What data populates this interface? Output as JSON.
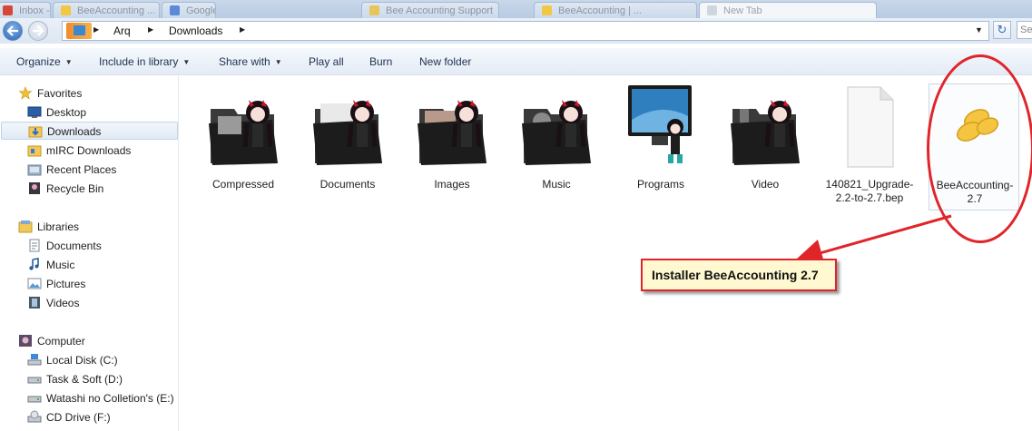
{
  "tabs": [
    {
      "label": "Inbox - ..."
    },
    {
      "label": "BeeAccounting ..."
    },
    {
      "label": "Google ..."
    },
    {
      "label": "Bee Accounting Support"
    },
    {
      "label": "BeeAccounting | ..."
    },
    {
      "label": "New Tab"
    }
  ],
  "address": {
    "crumbs": [
      "Arq",
      "Downloads"
    ],
    "search_placeholder": "Se"
  },
  "commands": {
    "organize": "Organize",
    "include": "Include in library",
    "share": "Share with",
    "play": "Play all",
    "burn": "Burn",
    "new_folder": "New folder"
  },
  "nav": {
    "favorites": "Favorites",
    "desktop": "Desktop",
    "downloads": "Downloads",
    "mirc": "mIRC Downloads",
    "recent": "Recent Places",
    "recycle": "Recycle Bin",
    "libraries": "Libraries",
    "documents": "Documents",
    "music": "Music",
    "pictures": "Pictures",
    "videos": "Videos",
    "computer": "Computer",
    "local_c": "Local Disk (C:)",
    "task_d": "Task & Soft (D:)",
    "watashi_e": "Watashi no Colletion's (E:)",
    "cd_f": "CD Drive (F:)"
  },
  "files": {
    "compressed": "Compressed",
    "documents": "Documents",
    "images": "Images",
    "music": "Music",
    "programs": "Programs",
    "video": "Video",
    "bep_file": "140821_Upgrade-2.2-to-2.7.bep",
    "bee_installer": "BeeAccounting-2.7"
  },
  "annotation": {
    "text": "Installer BeeAccounting 2.7"
  },
  "colors": {
    "annotation_red": "#e0252a",
    "callout_fill": "#fff8d0",
    "bee_icon": "#f5c542"
  }
}
